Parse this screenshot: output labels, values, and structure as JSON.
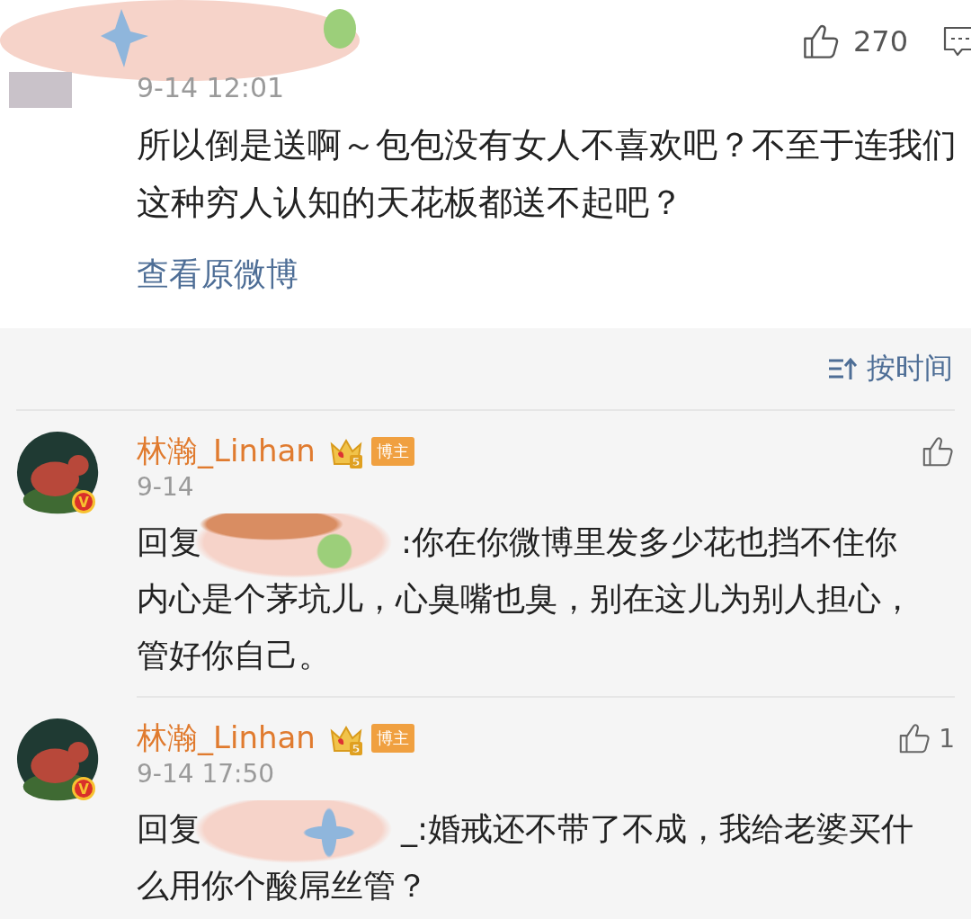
{
  "post": {
    "time": "9-14 12:01",
    "likes": "270",
    "text": "所以倒是送啊～包包没有女人不喜欢吧？不至于连我们这种穷人认知的天花板都送不起吧？",
    "link": "查看原微博"
  },
  "sort": {
    "label": "按时间"
  },
  "replies": [
    {
      "name": "林瀚_Linhan",
      "level": "5",
      "badge": "博主",
      "verified": "V",
      "time": "9-14",
      "prefix": "回复",
      "text": ":你在你微博里发多少花也挡不住你内心是个茅坑儿，心臭嘴也臭，别在这儿为别人担心，管好你自己。"
    },
    {
      "name": "林瀚_Linhan",
      "level": "5",
      "badge": "博主",
      "verified": "V",
      "time": "9-14 17:50",
      "prefix": "回复",
      "text": "_:婚戒还不带了不成，我给老婆买什么用你个酸屌丝管？",
      "likes": "1"
    }
  ]
}
